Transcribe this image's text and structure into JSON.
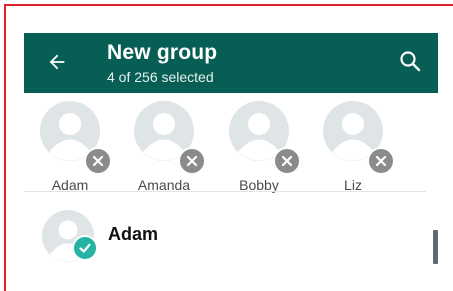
{
  "header": {
    "title": "New group",
    "subtitle": "4 of 256 selected",
    "back_icon": "arrow-left-icon",
    "search_icon": "search-icon",
    "background_color": "#075e54"
  },
  "selected_contacts": [
    {
      "name": "Adam"
    },
    {
      "name": "Amanda"
    },
    {
      "name": "Bobby"
    },
    {
      "name": "Liz"
    }
  ],
  "contacts": [
    {
      "name": "Adam",
      "selected": true
    }
  ],
  "colors": {
    "frame": "#e0202a",
    "check_badge": "#25b3a4",
    "remove_badge": "#8b8b8b"
  }
}
